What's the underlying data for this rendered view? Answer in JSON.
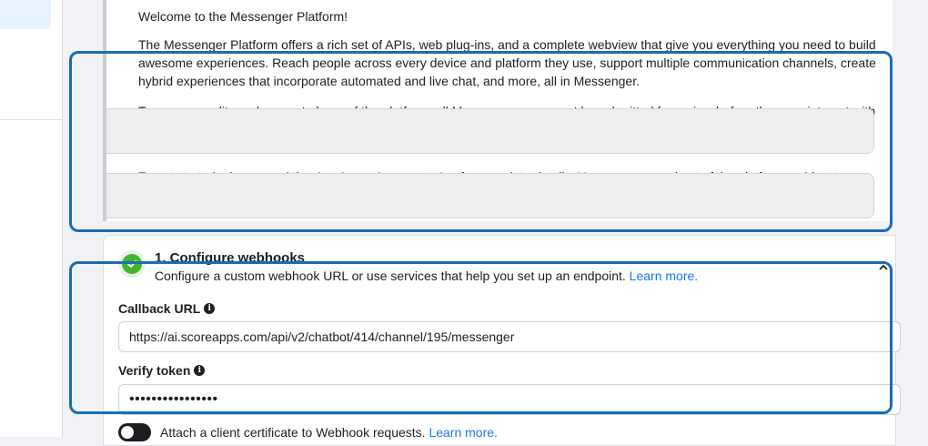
{
  "intro": {
    "welcome": "Welcome to the Messenger Platform!",
    "description": "The Messenger Platform offers a rich set of APIs, web plug-ins, and a complete webview that give you everything you need to build awesome experiences. Reach people across every device and platform they use, support multiple communication channels, create hybrid experiences that incorporate automated and live chat, and more, all in Messenger.",
    "review_text_partial": "To ensure quality and prevent abuse of the platform, all Messenger apps must be submitted for review before they can interact with",
    "docs_text_before": "To get started, please read the ",
    "docs_link": "developer documentation",
    "docs_text_after": " for complete details. You can use a subset of the platform, subject to"
  },
  "webhooks": {
    "title": "1. Configure webhooks",
    "description": "Configure a custom webhook URL or use services that help you set up an endpoint.",
    "learn_more": "Learn more.",
    "callback_label": "Callback URL",
    "callback_value": "https://ai.scoreapps.com/api/v2/chatbot/414/channel/195/messenger",
    "verify_label": "Verify token",
    "verify_value": "••••••••••••••••",
    "cert_toggle_label": "Attach a client certificate to Webhook requests.",
    "cert_learn_more": "Learn more.",
    "status": "complete"
  },
  "icons": {
    "check": "check-circle-icon",
    "info": "info-icon",
    "collapse": "chevron-up-icon"
  },
  "colors": {
    "accent": "#1877f2",
    "success": "#42b72a",
    "highlight": "#1c6bb5"
  }
}
